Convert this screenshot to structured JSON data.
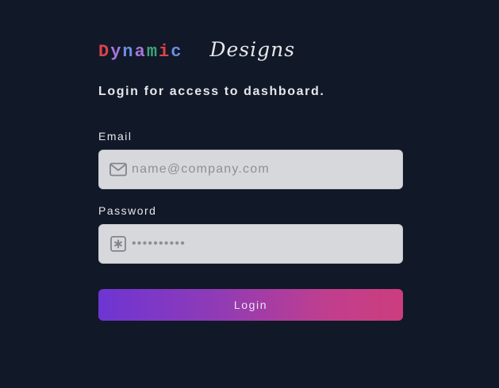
{
  "brand": {
    "letters": [
      {
        "char": "D",
        "color": "#d9434c"
      },
      {
        "char": "y",
        "color": "#a577d9"
      },
      {
        "char": "n",
        "color": "#6d8de0"
      },
      {
        "char": "a",
        "color": "#a577d9"
      },
      {
        "char": "m",
        "color": "#3ea276"
      },
      {
        "char": "i",
        "color": "#d9434c"
      },
      {
        "char": "c",
        "color": "#6d8de0"
      }
    ],
    "word2": "Designs"
  },
  "heading": "Login for access to dashboard.",
  "email": {
    "label": "Email",
    "placeholder": "name@company.com",
    "icon": "mail-icon"
  },
  "password": {
    "label": "Password",
    "placeholder": "••••••••••",
    "icon": "asterisk-box-icon"
  },
  "login_button": {
    "label": "Login"
  },
  "colors": {
    "background": "#111827",
    "input_bg": "#d6d8db",
    "button_gradient_start": "#6d35d3",
    "button_gradient_end": "#cc3d7d"
  }
}
